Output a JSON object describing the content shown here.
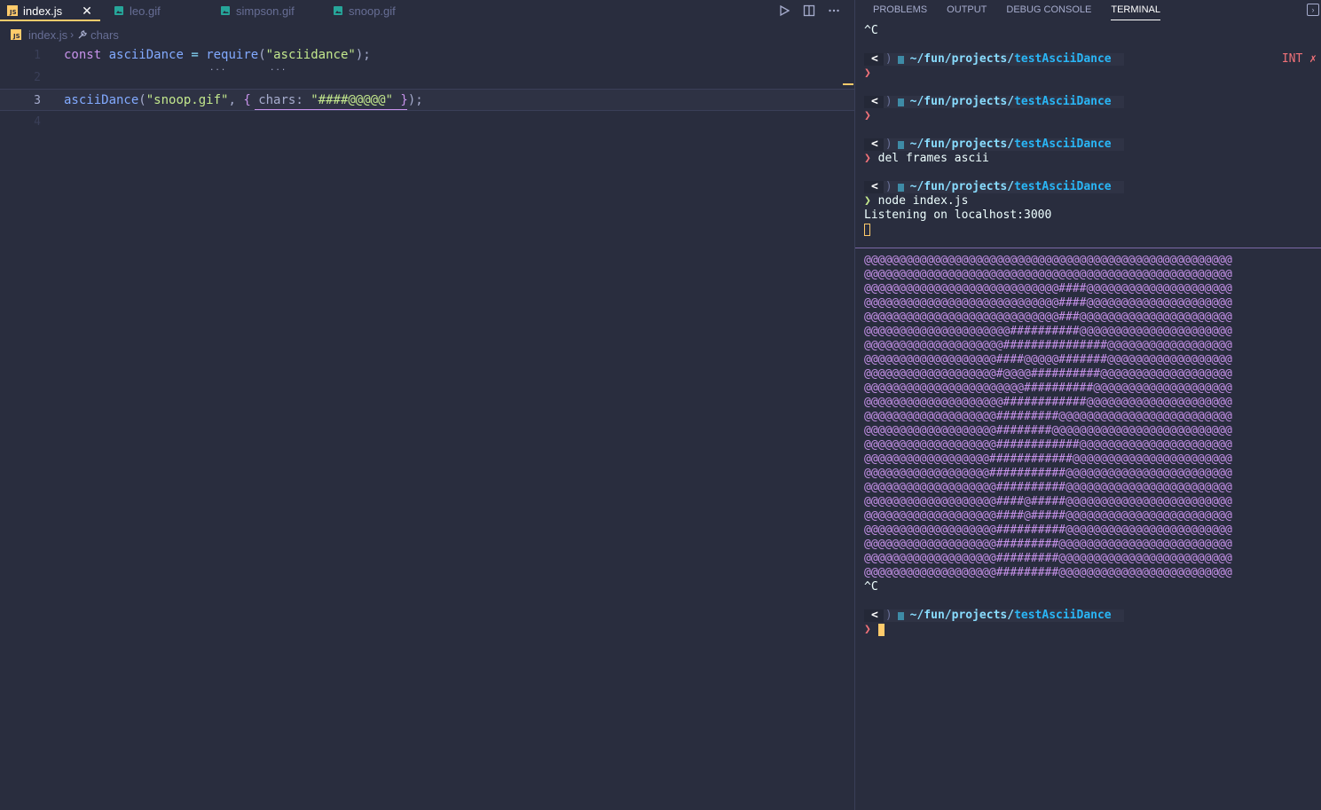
{
  "editor": {
    "tabs": [
      {
        "label": "index.js",
        "icon": "js-file-icon",
        "active": true
      },
      {
        "label": "leo.gif",
        "icon": "image-file-icon",
        "active": false
      },
      {
        "label": "simpson.gif",
        "icon": "image-file-icon",
        "active": false
      },
      {
        "label": "snoop.gif",
        "icon": "image-file-icon",
        "active": false
      }
    ],
    "close_glyph": "✕",
    "actions": [
      "run-icon",
      "split-editor-icon",
      "more-actions-icon"
    ],
    "breadcrumb": {
      "file": "index.js",
      "symbol": "chars"
    },
    "lines": [
      {
        "number": "1"
      },
      {
        "number": "2"
      },
      {
        "number": "3"
      },
      {
        "number": "4"
      }
    ],
    "code": {
      "l1_const": "const",
      "l1_var": "asciiDance",
      "l1_eq": "=",
      "l1_fn": "require",
      "l1_open": "(",
      "l1_str": "\"asciidance\"",
      "l1_close": ");",
      "l3_fn": "asciiDance",
      "l3_open": "(",
      "l3_str1": "\"snoop.gif\"",
      "l3_comma": ",",
      "l3_brace_open": "{",
      "l3_prop": "chars",
      "l3_colon": ":",
      "l3_str2": "\"####@@@@@\"",
      "l3_brace_close": "}",
      "l3_end": ");",
      "hint_dots": "..."
    },
    "colors": {
      "accent": "#ffcb6b",
      "background": "#292d3e",
      "keyword": "#c792ea",
      "function": "#82aaff",
      "string": "#c3e88d"
    }
  },
  "panel": {
    "tabs": [
      "PROBLEMS",
      "OUTPUT",
      "DEBUG CONSOLE",
      "TERMINAL"
    ],
    "active_tab": "TERMINAL",
    "collapse_icon": "chevron-right-icon"
  },
  "terminal": {
    "prompt": {
      "chevron": "<",
      "paren": ")",
      "path": "~/fun/projects/",
      "project": "testAsciiDance"
    },
    "arrow": "❯",
    "ctrl_c": "^C",
    "int_label": "INT",
    "int_mark": "✗",
    "cmd_del": "del frames ascii",
    "cmd_node": "node index.js",
    "listening": "Listening on localhost:3000",
    "ascii_frame": [
      "@@@@@@@@@@@@@@@@@@@@@@@@@@@@@@@@@@@@@@@@@@@@@@@@@@@@@",
      "@@@@@@@@@@@@@@@@@@@@@@@@@@@@@@@@@@@@@@@@@@@@@@@@@@@@@",
      "@@@@@@@@@@@@@@@@@@@@@@@@@@@@####@@@@@@@@@@@@@@@@@@@@@",
      "@@@@@@@@@@@@@@@@@@@@@@@@@@@@####@@@@@@@@@@@@@@@@@@@@@",
      "@@@@@@@@@@@@@@@@@@@@@@@@@@@@###@@@@@@@@@@@@@@@@@@@@@@",
      "@@@@@@@@@@@@@@@@@@@@@##########@@@@@@@@@@@@@@@@@@@@@@",
      "@@@@@@@@@@@@@@@@@@@@###############@@@@@@@@@@@@@@@@@@",
      "@@@@@@@@@@@@@@@@@@@####@@@@@#######@@@@@@@@@@@@@@@@@@",
      "@@@@@@@@@@@@@@@@@@@#@@@@##########@@@@@@@@@@@@@@@@@@@",
      "@@@@@@@@@@@@@@@@@@@@@@@##########@@@@@@@@@@@@@@@@@@@@",
      "@@@@@@@@@@@@@@@@@@@@############@@@@@@@@@@@@@@@@@@@@@",
      "@@@@@@@@@@@@@@@@@@@#########@@@@@@@@@@@@@@@@@@@@@@@@@",
      "@@@@@@@@@@@@@@@@@@@########@@@@@@@@@@@@@@@@@@@@@@@@@@",
      "@@@@@@@@@@@@@@@@@@@############@@@@@@@@@@@@@@@@@@@@@@",
      "@@@@@@@@@@@@@@@@@@############@@@@@@@@@@@@@@@@@@@@@@@",
      "@@@@@@@@@@@@@@@@@@###########@@@@@@@@@@@@@@@@@@@@@@@@",
      "@@@@@@@@@@@@@@@@@@@##########@@@@@@@@@@@@@@@@@@@@@@@@",
      "@@@@@@@@@@@@@@@@@@@####@#####@@@@@@@@@@@@@@@@@@@@@@@@",
      "@@@@@@@@@@@@@@@@@@@####@#####@@@@@@@@@@@@@@@@@@@@@@@@",
      "@@@@@@@@@@@@@@@@@@@##########@@@@@@@@@@@@@@@@@@@@@@@@",
      "@@@@@@@@@@@@@@@@@@@#########@@@@@@@@@@@@@@@@@@@@@@@@@",
      "@@@@@@@@@@@@@@@@@@@#########@@@@@@@@@@@@@@@@@@@@@@@@@",
      "@@@@@@@@@@@@@@@@@@@#########@@@@@@@@@@@@@@@@@@@@@@@@@"
    ]
  }
}
